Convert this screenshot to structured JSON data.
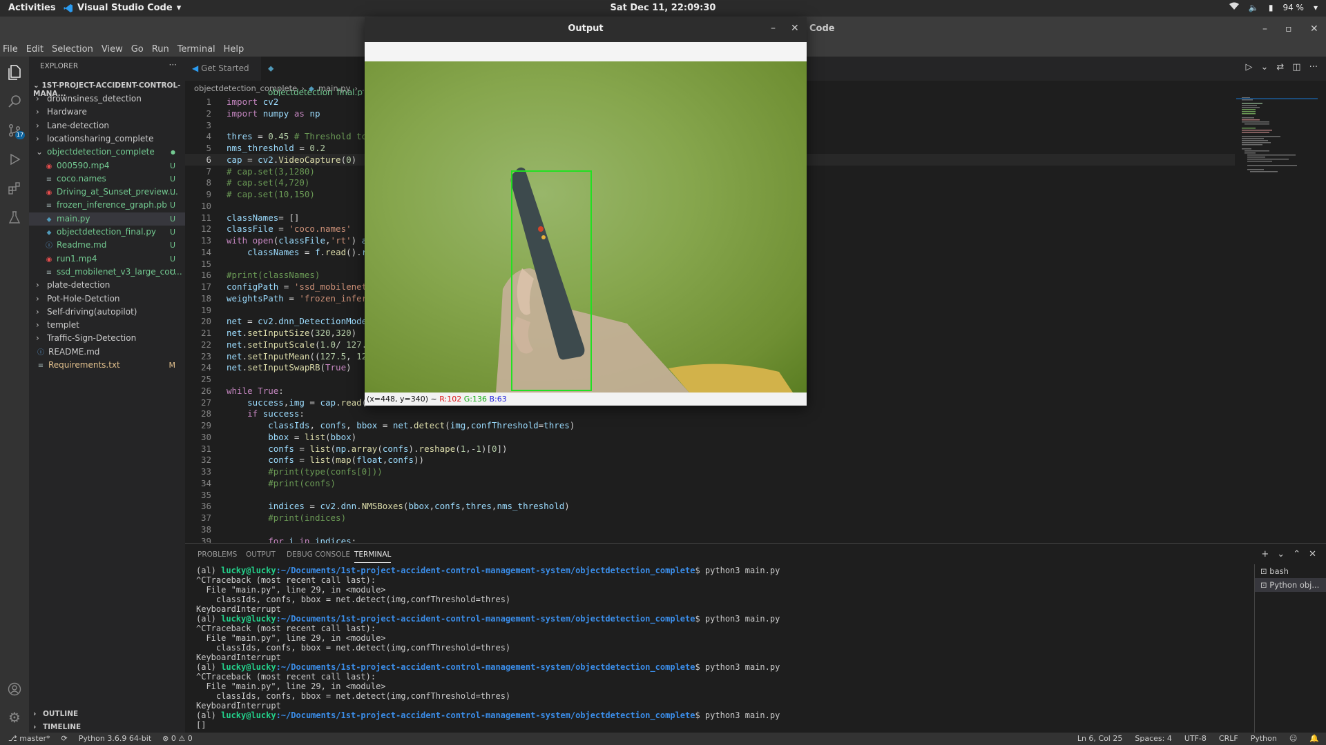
{
  "topbar": {
    "activities": "Activities",
    "app_name": "Visual Studio Code",
    "clock": "Sat Dec 11, 22:09:30",
    "battery": "94 %"
  },
  "window": {
    "title": "Code",
    "menu": [
      "File",
      "Edit",
      "Selection",
      "View",
      "Go",
      "Run",
      "Terminal",
      "Help"
    ]
  },
  "activity_badge": "17",
  "explorer": {
    "header": "EXPLORER",
    "project": "1ST-PROJECT-ACCIDENT-CONTROL-MANA...",
    "items": [
      {
        "label": "drownsiness_detection",
        "kind": "folder",
        "depth": 0,
        "status": ""
      },
      {
        "label": "Hardware",
        "kind": "folder",
        "depth": 0,
        "status": ""
      },
      {
        "label": "Lane-detection",
        "kind": "folder",
        "depth": 0,
        "status": ""
      },
      {
        "label": "locationsharing_complete",
        "kind": "folder",
        "depth": 0,
        "status": ""
      },
      {
        "label": "objectdetection_complete",
        "kind": "folder-open",
        "depth": 0,
        "status": "●"
      },
      {
        "label": "000590.mp4",
        "kind": "media",
        "depth": 1,
        "status": "U"
      },
      {
        "label": "coco.names",
        "kind": "text",
        "depth": 1,
        "status": "U"
      },
      {
        "label": "Driving_at_Sunset_preview....",
        "kind": "media",
        "depth": 1,
        "status": "U"
      },
      {
        "label": "frozen_inference_graph.pb",
        "kind": "text",
        "depth": 1,
        "status": "U"
      },
      {
        "label": "main.py",
        "kind": "python",
        "depth": 1,
        "status": "U"
      },
      {
        "label": "objectdetection_final.py",
        "kind": "python",
        "depth": 1,
        "status": "U"
      },
      {
        "label": "Readme.md",
        "kind": "info",
        "depth": 1,
        "status": "U"
      },
      {
        "label": "run1.mp4",
        "kind": "media",
        "depth": 1,
        "status": "U"
      },
      {
        "label": "ssd_mobilenet_v3_large_coc...",
        "kind": "text",
        "depth": 1,
        "status": "U"
      },
      {
        "label": "plate-detection",
        "kind": "folder",
        "depth": 0,
        "status": ""
      },
      {
        "label": "Pot-Hole-Detction",
        "kind": "folder",
        "depth": 0,
        "status": ""
      },
      {
        "label": "Self-driving(autopilot)",
        "kind": "folder",
        "depth": 0,
        "status": ""
      },
      {
        "label": "templet",
        "kind": "folder",
        "depth": 0,
        "status": ""
      },
      {
        "label": "Traffic-Sign-Detection",
        "kind": "folder",
        "depth": 0,
        "status": ""
      },
      {
        "label": "README.md",
        "kind": "info",
        "depth": -1,
        "status": ""
      },
      {
        "label": "Requirements.txt",
        "kind": "text",
        "depth": -1,
        "status": "M"
      }
    ],
    "outline": "OUTLINE",
    "timeline": "TIMELINE"
  },
  "tabs": [
    {
      "label": "Get Started"
    },
    {
      "label": "objectdetection_final.p"
    }
  ],
  "breadcrumb": [
    "objectdetection_complete",
    "main.py",
    "..."
  ],
  "code": [
    "import cv2",
    "import numpy as np",
    "",
    "thres = 0.45 # Threshold to",
    "nms_threshold = 0.2",
    "cap = cv2.VideoCapture(0)",
    "# cap.set(3,1280)",
    "# cap.set(4,720)",
    "# cap.set(10,150)",
    "",
    "classNames= []",
    "classFile = 'coco.names'",
    "with open(classFile,'rt') a",
    "    classNames = f.read().r",
    "",
    "#print(classNames)",
    "configPath = 'ssd_mobilenet",
    "weightsPath = 'frozen_infer",
    "",
    "net = cv2.dnn_DetectionMode",
    "net.setInputSize(320,320)",
    "net.setInputScale(1.0/ 127.",
    "net.setInputMean((127.5, 12",
    "net.setInputSwapRB(True)",
    "",
    "while True:",
    "    success,img = cap.read(",
    "    if success:",
    "        classIds, confs, bbox = net.detect(img,confThreshold=thres)",
    "        bbox = list(bbox)",
    "        confs = list(np.array(confs).reshape(1,-1)[0])",
    "        confs = list(map(float,confs))",
    "        #print(type(confs[0]))",
    "        #print(confs)",
    "",
    "        indices = cv2.dnn.NMSBoxes(bbox,confs,thres,nms_threshold)",
    "        #print(indices)",
    "",
    "        for i in indices:"
  ],
  "current_line": 6,
  "panel": {
    "tabs": [
      "PROBLEMS",
      "OUTPUT",
      "DEBUG CONSOLE",
      "TERMINAL"
    ],
    "active_tab": "TERMINAL",
    "terminal_lines": [
      {
        "env": "(al) ",
        "user": "lucky@lucky",
        "path": ":~/Documents/1st-project-accident-control-management-system/objectdetection_complete",
        "cmd": "$ python3 main.py"
      },
      {
        "text": "^CTraceback (most recent call last):"
      },
      {
        "text": "  File \"main.py\", line 29, in <module>"
      },
      {
        "text": "    classIds, confs, bbox = net.detect(img,confThreshold=thres)"
      },
      {
        "text": "KeyboardInterrupt"
      },
      {
        "env": "(al) ",
        "user": "lucky@lucky",
        "path": ":~/Documents/1st-project-accident-control-management-system/objectdetection_complete",
        "cmd": "$ python3 main.py"
      },
      {
        "text": "^CTraceback (most recent call last):"
      },
      {
        "text": "  File \"main.py\", line 29, in <module>"
      },
      {
        "text": "    classIds, confs, bbox = net.detect(img,confThreshold=thres)"
      },
      {
        "text": "KeyboardInterrupt"
      },
      {
        "env": "(al) ",
        "user": "lucky@lucky",
        "path": ":~/Documents/1st-project-accident-control-management-system/objectdetection_complete",
        "cmd": "$ python3 main.py"
      },
      {
        "text": "^CTraceback (most recent call last):"
      },
      {
        "text": "  File \"main.py\", line 29, in <module>"
      },
      {
        "text": "    classIds, confs, bbox = net.detect(img,confThreshold=thres)"
      },
      {
        "text": "KeyboardInterrupt"
      },
      {
        "env": "(al) ",
        "user": "lucky@lucky",
        "path": ":~/Documents/1st-project-accident-control-management-system/objectdetection_complete",
        "cmd": "$ python3 main.py"
      },
      {
        "text": "[]"
      }
    ],
    "terminals": [
      "bash",
      "Python obj..."
    ]
  },
  "statusbar": {
    "branch": "master*",
    "interpreter": "Python 3.6.9 64-bit",
    "problems": "⊗ 0 ⚠ 0",
    "cursor": "Ln 6, Col 25",
    "spaces": "Spaces: 4",
    "encoding": "UTF-8",
    "eol": "CRLF",
    "language": "Python"
  },
  "output_window": {
    "title": "Output",
    "status_prefix": "(x=448, y=340) ~ ",
    "r": "R:102",
    "g": "G:136",
    "b": "B:63",
    "box_color": "#22e022"
  }
}
